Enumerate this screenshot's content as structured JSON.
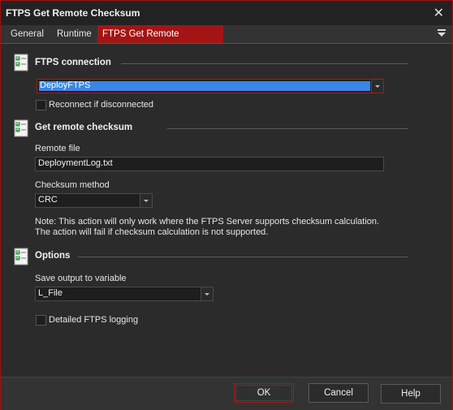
{
  "window": {
    "title": "FTPS Get Remote Checksum",
    "close_glyph": "✕"
  },
  "tabs": [
    {
      "label": "General"
    },
    {
      "label": "Runtime"
    },
    {
      "label": "FTPS Get Remote Checksum",
      "active": true
    }
  ],
  "sections": {
    "connection": {
      "title": "FTPS connection",
      "connection_value": "DeployFTPS",
      "reconnect_label": "Reconnect if disconnected",
      "reconnect_checked": false
    },
    "checksum": {
      "title": "Get remote checksum",
      "remote_file_label": "Remote file",
      "remote_file_value": "DeploymentLog.txt",
      "method_label": "Checksum method",
      "method_value": "CRC",
      "note_line1": "Note: This action will only work where the FTPS Server supports checksum calculation.",
      "note_line2": "The action will fail if checksum calculation is not supported."
    },
    "options": {
      "title": "Options",
      "save_label": "Save output to variable",
      "save_value": "L_File",
      "logging_label": "Detailed FTPS logging",
      "logging_checked": false
    }
  },
  "footer": {
    "ok_label": "OK",
    "cancel_label": "Cancel",
    "help_label": "Help"
  },
  "icons": {
    "section_icon": "checklist-icon",
    "dropdown_icon": "chevron-down-icon",
    "tab_menu_icon": "tab-menu-icon"
  },
  "colors": {
    "accent": "#a31515",
    "selection": "#3a86e6",
    "background": "#2b2b2b"
  }
}
